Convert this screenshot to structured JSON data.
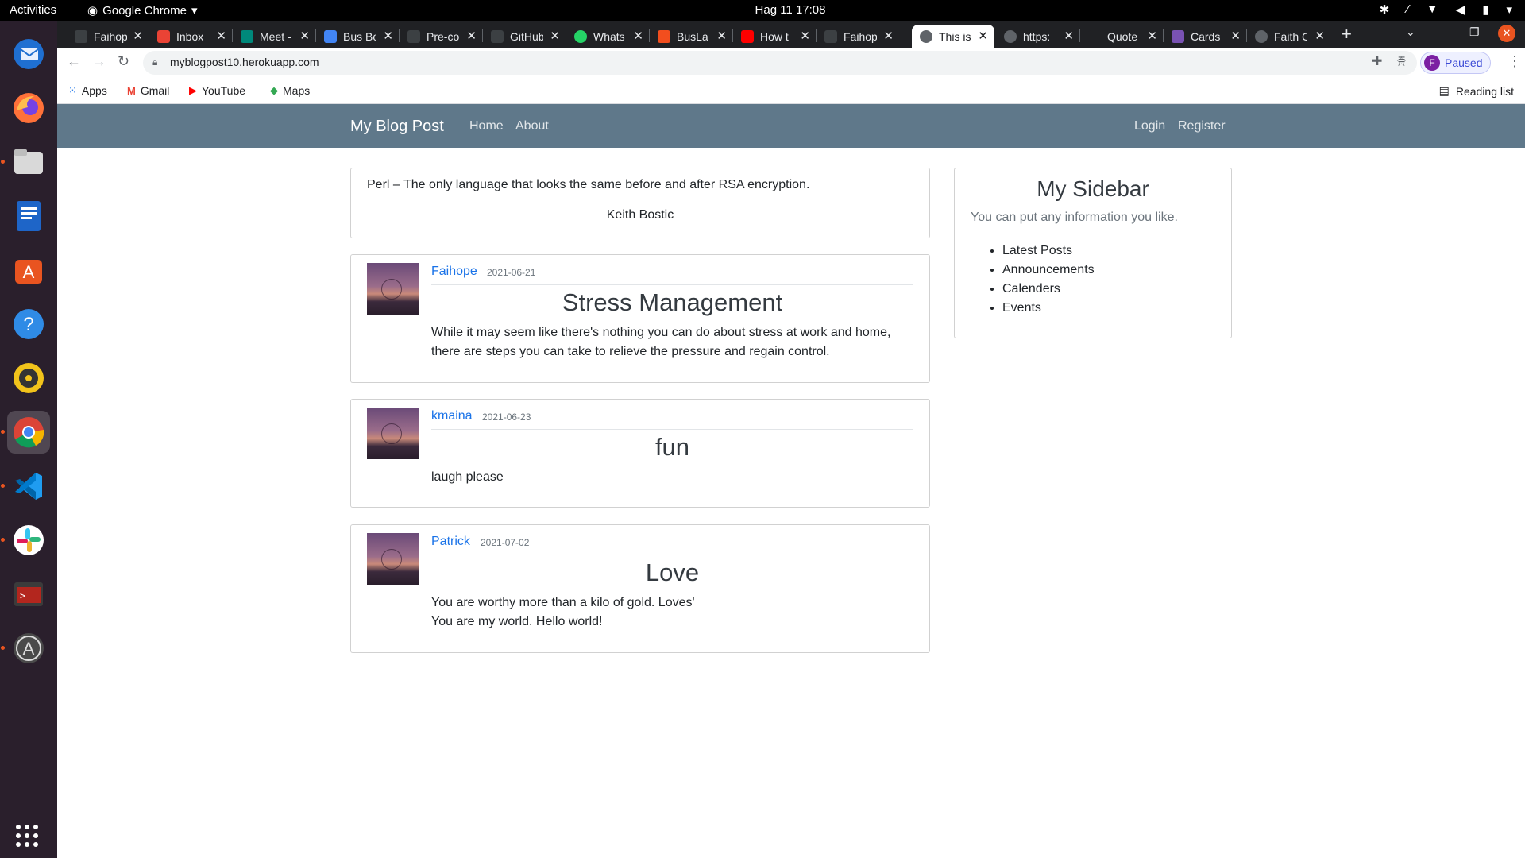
{
  "os": {
    "activities": "Activities",
    "app_name": "Google Chrome",
    "clock": "Hag 11  17:08"
  },
  "tabs": [
    {
      "label": "Faihope",
      "icon_color": "#3c4043"
    },
    {
      "label": "Inbox",
      "icon_color": "#ea4335"
    },
    {
      "label": "Meet -",
      "icon_color": "#00897b"
    },
    {
      "label": "Bus Bo",
      "icon_color": "#4285f4"
    },
    {
      "label": "Pre-co",
      "icon_color": "#3c4043"
    },
    {
      "label": "GitHub",
      "icon_color": "#3c4043"
    },
    {
      "label": "Whats",
      "icon_color": "#25d366"
    },
    {
      "label": "BusLa",
      "icon_color": "#f24e1e"
    },
    {
      "label": "How t",
      "icon_color": "#ff0000"
    },
    {
      "label": "Faihop",
      "icon_color": "#3c4043"
    },
    {
      "label": "This is",
      "icon_color": "#5f6368"
    },
    {
      "label": "https:",
      "icon_color": "#5f6368"
    },
    {
      "label": "Quote",
      "icon_color": "#202124"
    },
    {
      "label": "Cards",
      "icon_color": "#7952b3"
    },
    {
      "label": "Faith C",
      "icon_color": "#5f6368"
    }
  ],
  "toolbar": {
    "url": "myblogpost10.herokuapp.com",
    "profile_initial": "F",
    "profile_status": "Paused"
  },
  "bookmarks": {
    "items": [
      "Apps",
      "Gmail",
      "YouTube",
      "Maps"
    ],
    "reading_list": "Reading list"
  },
  "site": {
    "brand": "My Blog Post",
    "nav": {
      "home": "Home",
      "about": "About",
      "login": "Login",
      "register": "Register"
    },
    "quote": {
      "text": "Perl – The only language that looks the same before and after RSA encryption.",
      "author": "Keith Bostic"
    },
    "posts": [
      {
        "author": "Faihope",
        "date": "2021-06-21",
        "title": "Stress Management",
        "body": [
          "While it may seem like there's nothing you can do about stress at work and home,",
          "there are steps you can take to relieve the pressure and regain control."
        ]
      },
      {
        "author": "kmaina",
        "date": "2021-06-23",
        "title": "fun",
        "body": [
          "laugh please"
        ]
      },
      {
        "author": "Patrick",
        "date": "2021-07-02",
        "title": "Love",
        "body": [
          "You are worthy more than a kilo of gold. Loves'",
          "You are my world. Hello world!"
        ]
      }
    ],
    "sidebar": {
      "title": "My Sidebar",
      "description": "You can put any information you like.",
      "items": [
        "Latest Posts",
        "Announcements",
        "Calenders",
        "Events"
      ]
    }
  }
}
